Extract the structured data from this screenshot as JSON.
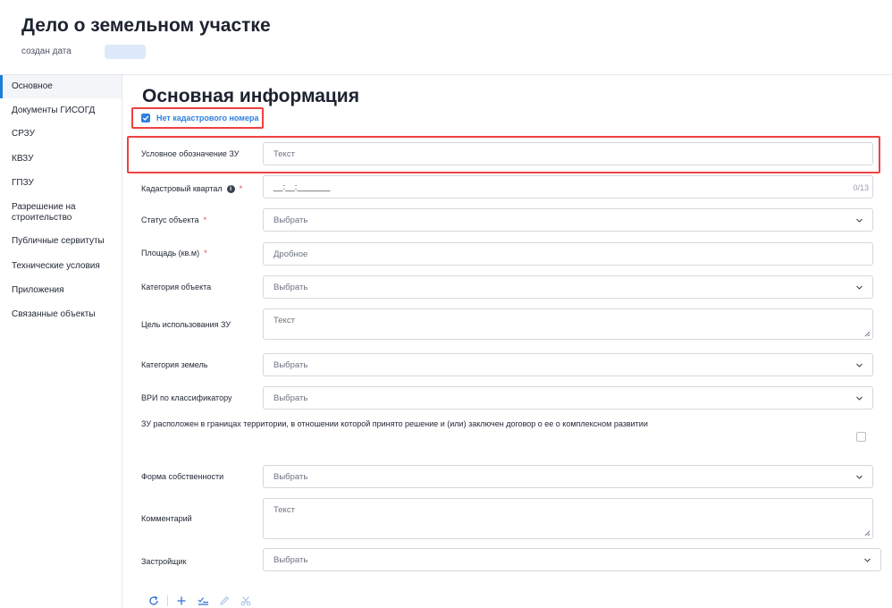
{
  "header": {
    "title": "Дело о земельном участке",
    "created_label": "создан дата"
  },
  "sidebar": {
    "items": [
      {
        "label": "Основное"
      },
      {
        "label": "Документы ГИСОГД"
      },
      {
        "label": "СРЗУ"
      },
      {
        "label": "КВЗУ"
      },
      {
        "label": "ГПЗУ"
      },
      {
        "label": "Разрешение на строительство"
      },
      {
        "label": "Публичные сервитуты"
      },
      {
        "label": "Технические условия"
      },
      {
        "label": "Приложения"
      },
      {
        "label": "Связанные объекты"
      }
    ],
    "active_index": 0
  },
  "main": {
    "section_title": "Основная информация",
    "no_cadastral_checkbox": {
      "label": "Нет кадастрового номера",
      "checked": true
    },
    "fields": {
      "conditional_designation": {
        "label": "Условное обозначение ЗУ",
        "placeholder": "Текст"
      },
      "cadastral_quarter": {
        "label": "Кадастровый квартал",
        "required_mark": "*",
        "mask": "__:__:_______",
        "counter": "0/13"
      },
      "object_status": {
        "label": "Статус объекта",
        "required_mark": "*",
        "placeholder": "Выбрать"
      },
      "area": {
        "label": "Площадь (кв.м)",
        "required_mark": "*",
        "placeholder": "Дробное"
      },
      "object_category": {
        "label": "Категория объекта",
        "placeholder": "Выбрать"
      },
      "usage_purpose": {
        "label": "Цель использования ЗУ",
        "placeholder": "Текст"
      },
      "land_category": {
        "label": "Категория земель",
        "placeholder": "Выбрать"
      },
      "vri_classifier": {
        "label": "ВРИ по классификатору",
        "placeholder": "Выбрать"
      },
      "complex_development": {
        "label": "ЗУ расположен в границах территории, в отношении которой принято решение и (или) заключен договор о ее о комплексном развитии",
        "checked": false
      },
      "ownership_form": {
        "label": "Форма собственности",
        "placeholder": "Выбрать"
      },
      "comment": {
        "label": "Комментарий",
        "placeholder": "Текст"
      },
      "developer": {
        "label": "Застройщик",
        "placeholder": "Выбрать"
      }
    }
  },
  "toolbar": {
    "icons": [
      "refresh-icon",
      "plus-icon",
      "checklist-icon",
      "pencil-icon",
      "scissors-icon"
    ]
  },
  "colors": {
    "accent": "#2f7fe0",
    "highlight": "#ef4141",
    "required": "#e5484d"
  }
}
